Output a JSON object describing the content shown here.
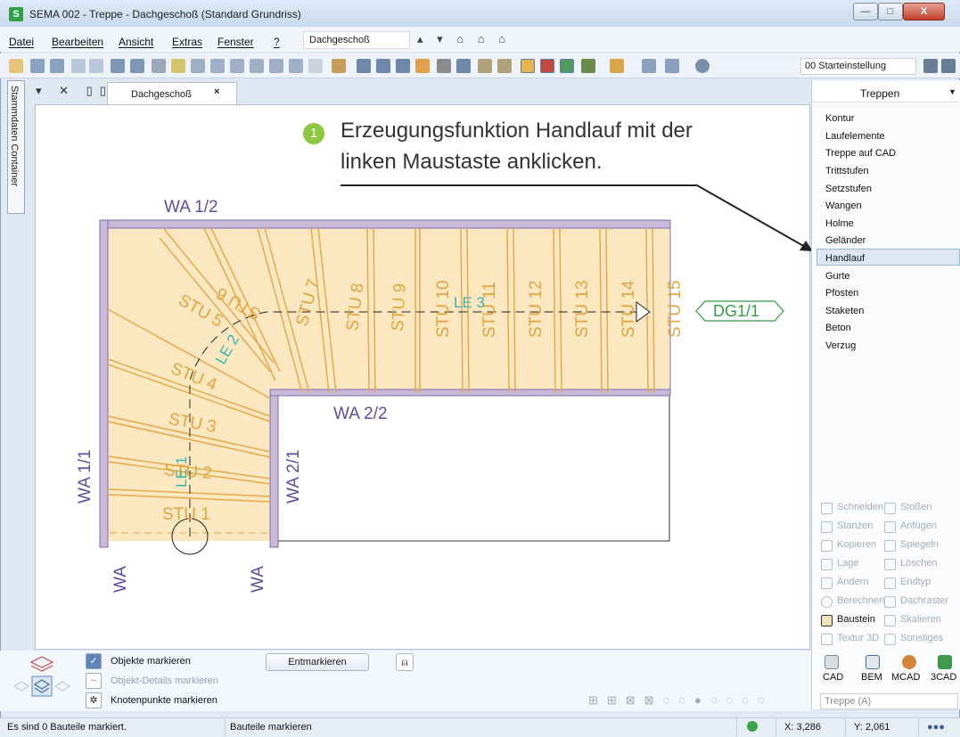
{
  "window": {
    "title": "SEMA  002 - Treppe  - Dachgeschoß (Standard Grundriss)",
    "app_icon_letter": "S",
    "controls": {
      "minimize": "—",
      "maximize": "□",
      "close": "X"
    }
  },
  "menu": {
    "items": [
      "Datei",
      "Bearbeiten",
      "Ansicht",
      "Extras",
      "Fenster",
      "?"
    ],
    "floor_select": "Dachgeschoß",
    "floor_arrows": "▴ ▾ ⌂ ⌂ ⌂"
  },
  "toolbar": {
    "starteinstellung": "00 Starteinstellung"
  },
  "left_strip": {
    "label": "Stammdaten Container"
  },
  "tab": {
    "tools": "▾ ✕ ▯▯",
    "doc_tab_label": "Dachgeschoß",
    "close": "×"
  },
  "callout": {
    "number": "1",
    "line1": "Erzeugungsfunktion  Handlauf  mit der",
    "line2": "linken Maustaste anklicken."
  },
  "plan": {
    "walls": {
      "wa_1_2": "WA 1/2",
      "wa_2_2": "WA 2/2",
      "wa_1_1": "WA 1/1",
      "wa_2_1": "WA 2/1",
      "wa_bottom_left": "WA",
      "wa_bottom_right": "WA"
    },
    "steps": [
      "STU 1",
      "STU 2",
      "STU 3",
      "STU 4",
      "STU 5",
      "STU 6",
      "STU 7",
      "STU 8",
      "STU 9",
      "STU 10",
      "STU 11",
      "STU 12",
      "STU 13",
      "STU 14",
      "STU 15"
    ],
    "run_lines": {
      "le1": "LE 1",
      "le2": "LE 2",
      "le3": "LE 3"
    },
    "target_label": "DG1/1",
    "colors": {
      "tread_fill": "#fbe7c0",
      "tread_stroke": "#e5a94a",
      "wall": "#7b6fb0",
      "label": "#5a4fa0",
      "run": "#36b5ae",
      "target": "#2f9e44"
    }
  },
  "panel": {
    "title": "Treppen",
    "dropdown": "▼",
    "items": [
      "Kontur",
      "Laufelemente",
      "Treppe auf CAD",
      "Trittstufen",
      "Setzstufen",
      "Wangen",
      "Holme",
      "Geländer",
      "Handlauf",
      "Gurte",
      "Pfosten",
      "Staketen",
      "Beton",
      "Verzug"
    ],
    "selected": "Handlauf",
    "tools_left": [
      "Schneiden",
      "Stanzen",
      "Kopieren",
      "Lage",
      "Ändern",
      "Berechnen",
      "Baustein",
      "Textur 3D"
    ],
    "tools_right": [
      "Stoßen",
      "Anfügen",
      "Spiegeln",
      "Löschen",
      "Endtyp",
      "Dachraster",
      "Skalieren",
      "Sonstiges"
    ],
    "active_tool": "Baustein",
    "modules": [
      "CAD",
      "BEM",
      "MCAD",
      "3CAD"
    ],
    "treppe_select": "Treppe (A)"
  },
  "marking": {
    "objekte": "Objekte markieren",
    "details": "Objekt-Details markieren",
    "knoten": "Knotenpunkte markieren",
    "entmarkieren": "Entmarkieren"
  },
  "status": {
    "left": "Es sind 0 Bauteile markiert.",
    "mode": "Bauteile markieren",
    "x": "X: 3,286",
    "y": "Y: 2,061",
    "dots": "●●●"
  }
}
